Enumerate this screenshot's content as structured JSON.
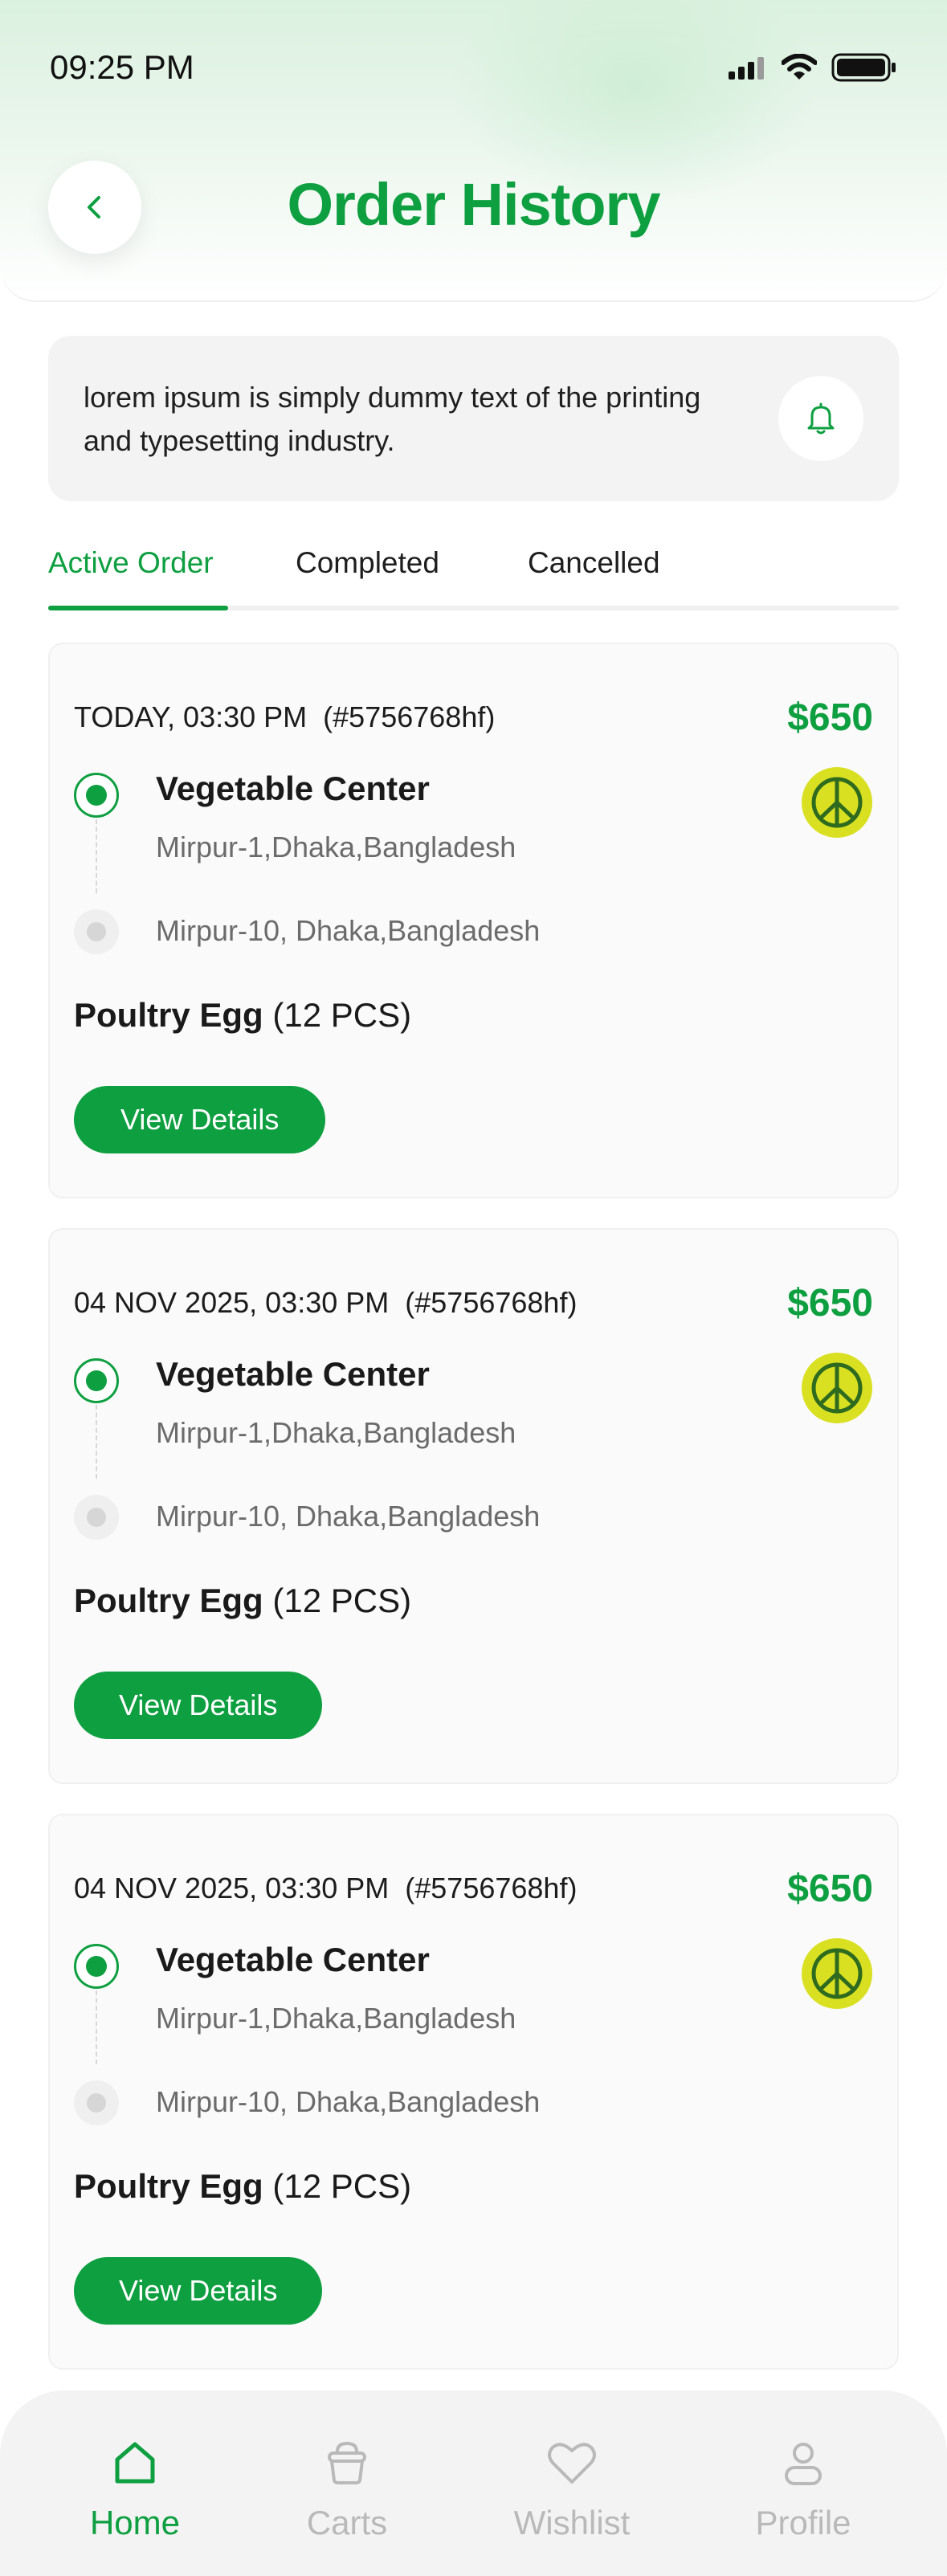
{
  "status_bar": {
    "time": "09:25 PM"
  },
  "header": {
    "title": "Order History"
  },
  "notice": {
    "text": "lorem ipsum is simply dummy text of the printing and typesetting industry."
  },
  "tabs": [
    {
      "label": "Active Order",
      "active": true
    },
    {
      "label": "Completed",
      "active": false
    },
    {
      "label": "Cancelled",
      "active": false
    }
  ],
  "orders": [
    {
      "date": "TODAY, 03:30 PM",
      "order_id": "(#5756768hf)",
      "price": "$650",
      "store": "Vegetable Center",
      "pickup_address": "Mirpur-1,Dhaka,Bangladesh",
      "dropoff_address": "Mirpur-10, Dhaka,Bangladesh",
      "product": "Poultry Egg",
      "quantity": "(12 PCS)",
      "button": "View Details"
    },
    {
      "date": "04 NOV 2025, 03:30 PM",
      "order_id": "(#5756768hf)",
      "price": "$650",
      "store": "Vegetable Center",
      "pickup_address": "Mirpur-1,Dhaka,Bangladesh",
      "dropoff_address": "Mirpur-10, Dhaka,Bangladesh",
      "product": "Poultry Egg",
      "quantity": "(12 PCS)",
      "button": "View Details"
    },
    {
      "date": "04 NOV 2025, 03:30 PM",
      "order_id": "(#5756768hf)",
      "price": "$650",
      "store": "Vegetable Center",
      "pickup_address": "Mirpur-1,Dhaka,Bangladesh",
      "dropoff_address": "Mirpur-10, Dhaka,Bangladesh",
      "product": "Poultry Egg",
      "quantity": "(12 PCS)",
      "button": "View Details"
    }
  ],
  "bottom_nav": [
    {
      "label": "Home",
      "icon": "home-icon",
      "active": true
    },
    {
      "label": "Carts",
      "icon": "basket-icon",
      "active": false
    },
    {
      "label": "Wishlist",
      "icon": "heart-icon",
      "active": false
    },
    {
      "label": "Profile",
      "icon": "user-icon",
      "active": false
    }
  ],
  "colors": {
    "accent": "#0e9f40",
    "muted": "#b9b9b9",
    "logo_yellow": "#d9e021"
  }
}
